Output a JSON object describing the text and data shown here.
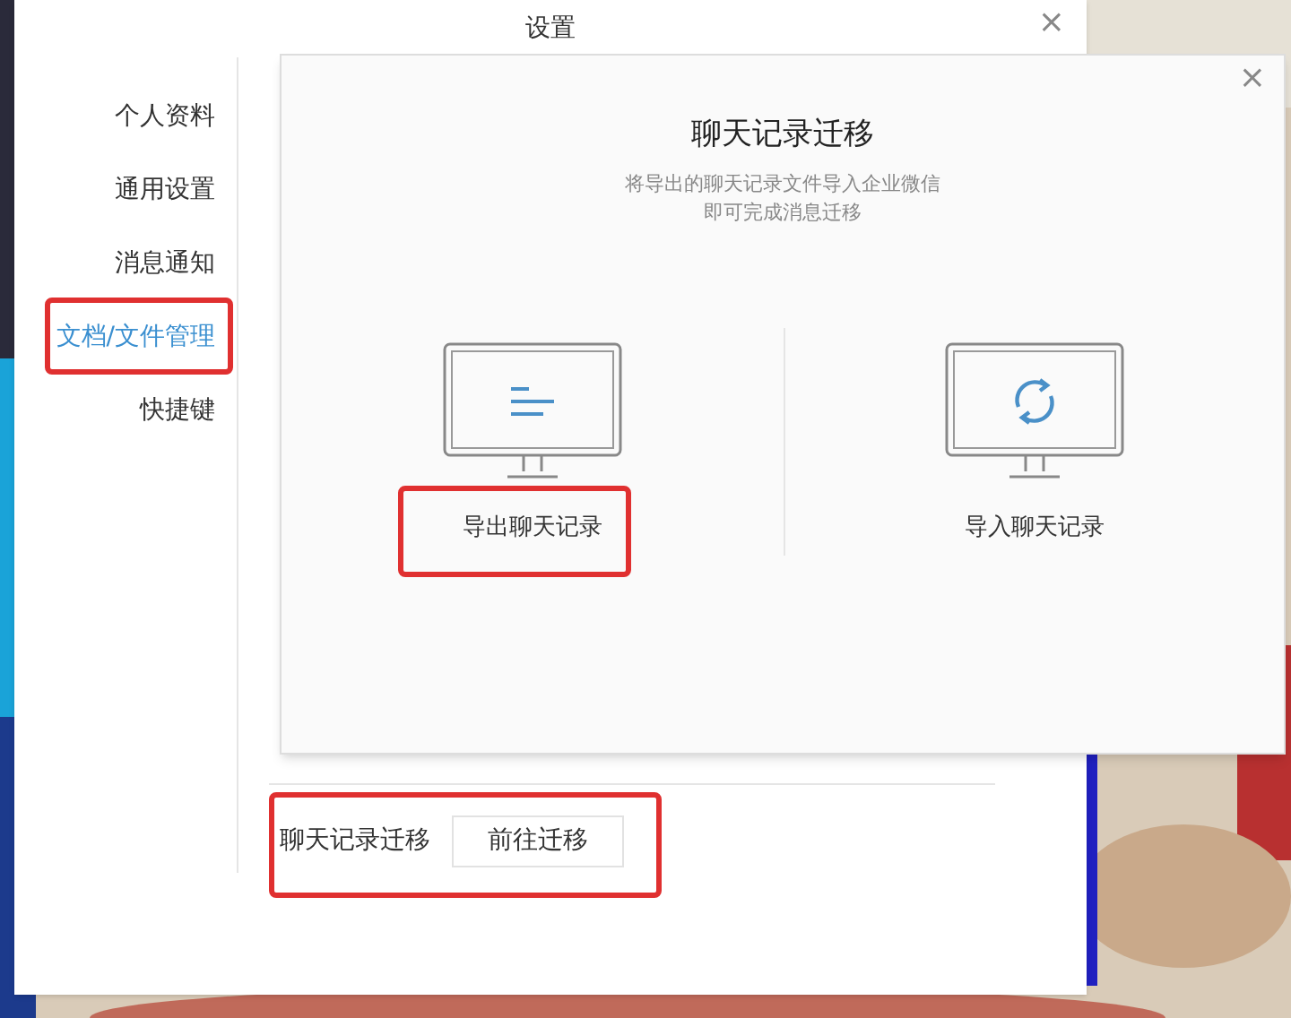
{
  "window": {
    "title": "设置",
    "close": "×"
  },
  "sidebar": {
    "items": [
      {
        "label": "个人资料",
        "selected": false,
        "highlighted": false
      },
      {
        "label": "通用设置",
        "selected": false,
        "highlighted": false
      },
      {
        "label": "消息通知",
        "selected": false,
        "highlighted": false
      },
      {
        "label": "文档/文件管理",
        "selected": true,
        "highlighted": true
      },
      {
        "label": "快捷键",
        "selected": false,
        "highlighted": false
      }
    ]
  },
  "migration_row": {
    "label": "聊天记录迁移",
    "button": "前往迁移",
    "highlighted": true
  },
  "dialog": {
    "title": "聊天记录迁移",
    "close": "×",
    "subtitle_lines": [
      "将导出的聊天记录文件导入企业微信",
      "即可完成消息迁移"
    ],
    "options": [
      {
        "kind": "export",
        "label": "导出聊天记录",
        "highlighted": true
      },
      {
        "kind": "import",
        "label": "导入聊天记录",
        "highlighted": false
      }
    ]
  }
}
